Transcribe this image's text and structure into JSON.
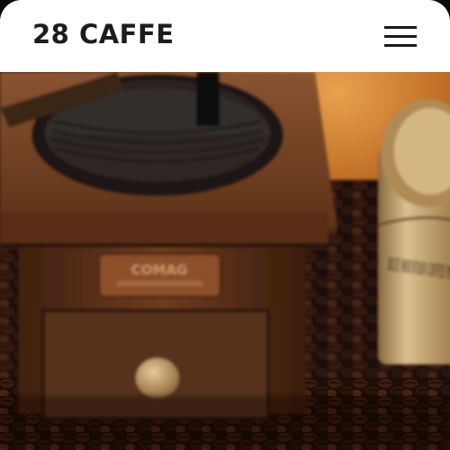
{
  "header": {
    "logo_text": "28 CAFFE",
    "menu_icon": "hamburger-menu-icon"
  },
  "hero": {
    "image_subject": "vintage coffee grinder with coffee beans and coffee tin",
    "grinder_plate_text": "COMAG",
    "tin_label_text": "BLUE MOUNTAIN COFFEE PRODUCT"
  },
  "colors": {
    "header_bg": "#ffffff",
    "logo_text": "#1c1c1c",
    "wood": "#6b3a1c",
    "beans": "#2a160c"
  }
}
